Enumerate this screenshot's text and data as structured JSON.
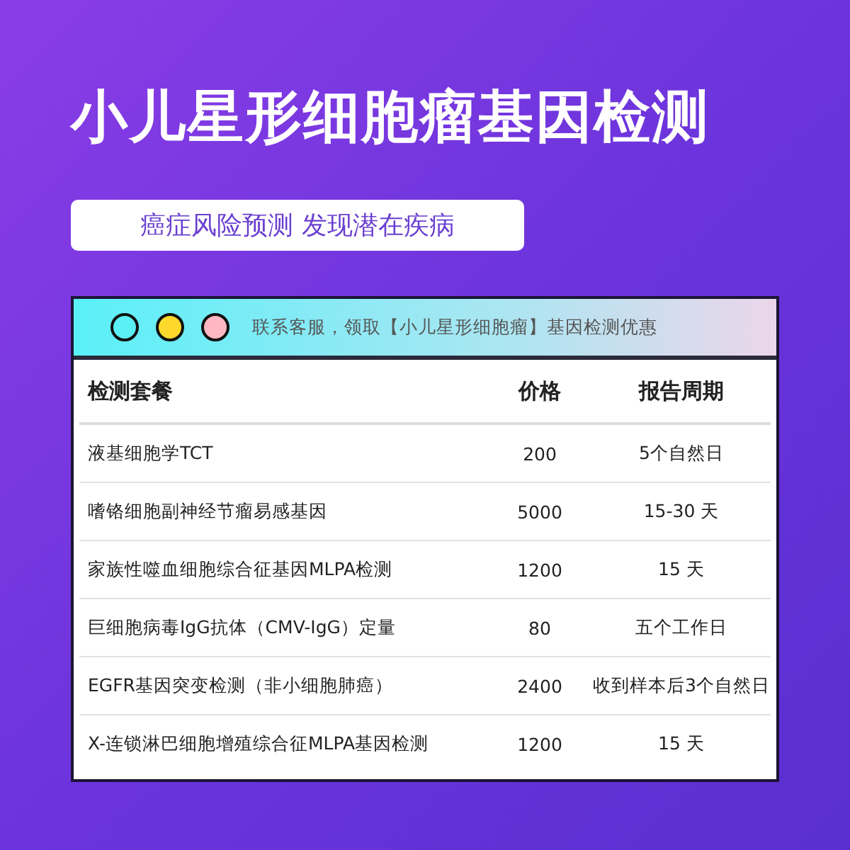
{
  "title": "小儿星形细胞瘤基因检测",
  "subtitle": "癌症风险预测 发现潜在疾病",
  "card": {
    "dots": [
      {
        "color": "#5af0f5"
      },
      {
        "color": "#fcd92c"
      },
      {
        "color": "#ffb8c2"
      }
    ],
    "notice": "联系客服，领取【小儿星形细胞瘤】基因检测优惠"
  },
  "table": {
    "columns": [
      "检测套餐",
      "价格",
      "报告周期"
    ],
    "rows": [
      [
        "液基细胞学TCT",
        "200",
        "5个自然日"
      ],
      [
        "嗜铬细胞副神经节瘤易感基因",
        "5000",
        "15-30 天"
      ],
      [
        "家族性噬血细胞综合征基因MLPA检测",
        "1200",
        "15 天"
      ],
      [
        "巨细胞病毒IgG抗体（CMV-IgG）定量",
        "80",
        "五个工作日"
      ],
      [
        "EGFR基因突变检测（非小细胞肺癌）",
        "2400",
        "收到样本后3个自然日"
      ],
      [
        "X-连锁淋巴细胞增殖综合征MLPA基因检测",
        "1200",
        "15 天"
      ]
    ]
  }
}
